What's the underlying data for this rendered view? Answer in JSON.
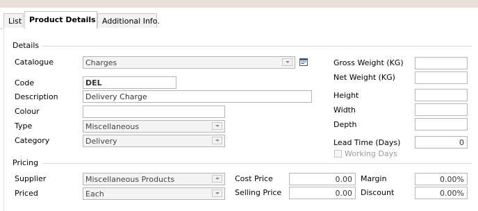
{
  "tabs": [
    {
      "label": "List"
    },
    {
      "label": "Product Details"
    },
    {
      "label": "Additional Info."
    }
  ],
  "details": {
    "section_label": "Details",
    "catalogue": {
      "label": "Catalogue",
      "value": "Charges"
    },
    "code": {
      "label": "Code",
      "value": "DEL"
    },
    "description": {
      "label": "Description",
      "value": "Delivery Charge"
    },
    "colour": {
      "label": "Colour",
      "value": ""
    },
    "type": {
      "label": "Type",
      "value": "Miscellaneous"
    },
    "category": {
      "label": "Category",
      "value": "Delivery"
    }
  },
  "measurements": {
    "gross_weight": {
      "label": "Gross Weight (KG)",
      "value": ""
    },
    "net_weight": {
      "label": "Net Weight (KG)",
      "value": ""
    },
    "height": {
      "label": "Height",
      "value": ""
    },
    "width": {
      "label": "Width",
      "value": ""
    },
    "depth": {
      "label": "Depth",
      "value": ""
    },
    "lead_time": {
      "label": "Lead Time (Days)",
      "value": "0"
    },
    "working_days": {
      "label": "Working Days",
      "checked": false
    }
  },
  "pricing": {
    "section_label": "Pricing",
    "supplier": {
      "label": "Supplier",
      "value": "Miscellaneous Products"
    },
    "priced": {
      "label": "Priced",
      "value": "Each"
    },
    "cost_price": {
      "label": "Cost Price",
      "value": "0.00"
    },
    "selling_price": {
      "label": "Selling Price",
      "value": "0.00"
    },
    "margin": {
      "label": "Margin",
      "value": "0.00%"
    },
    "discount": {
      "label": "Discount",
      "value": "0.00%"
    }
  }
}
